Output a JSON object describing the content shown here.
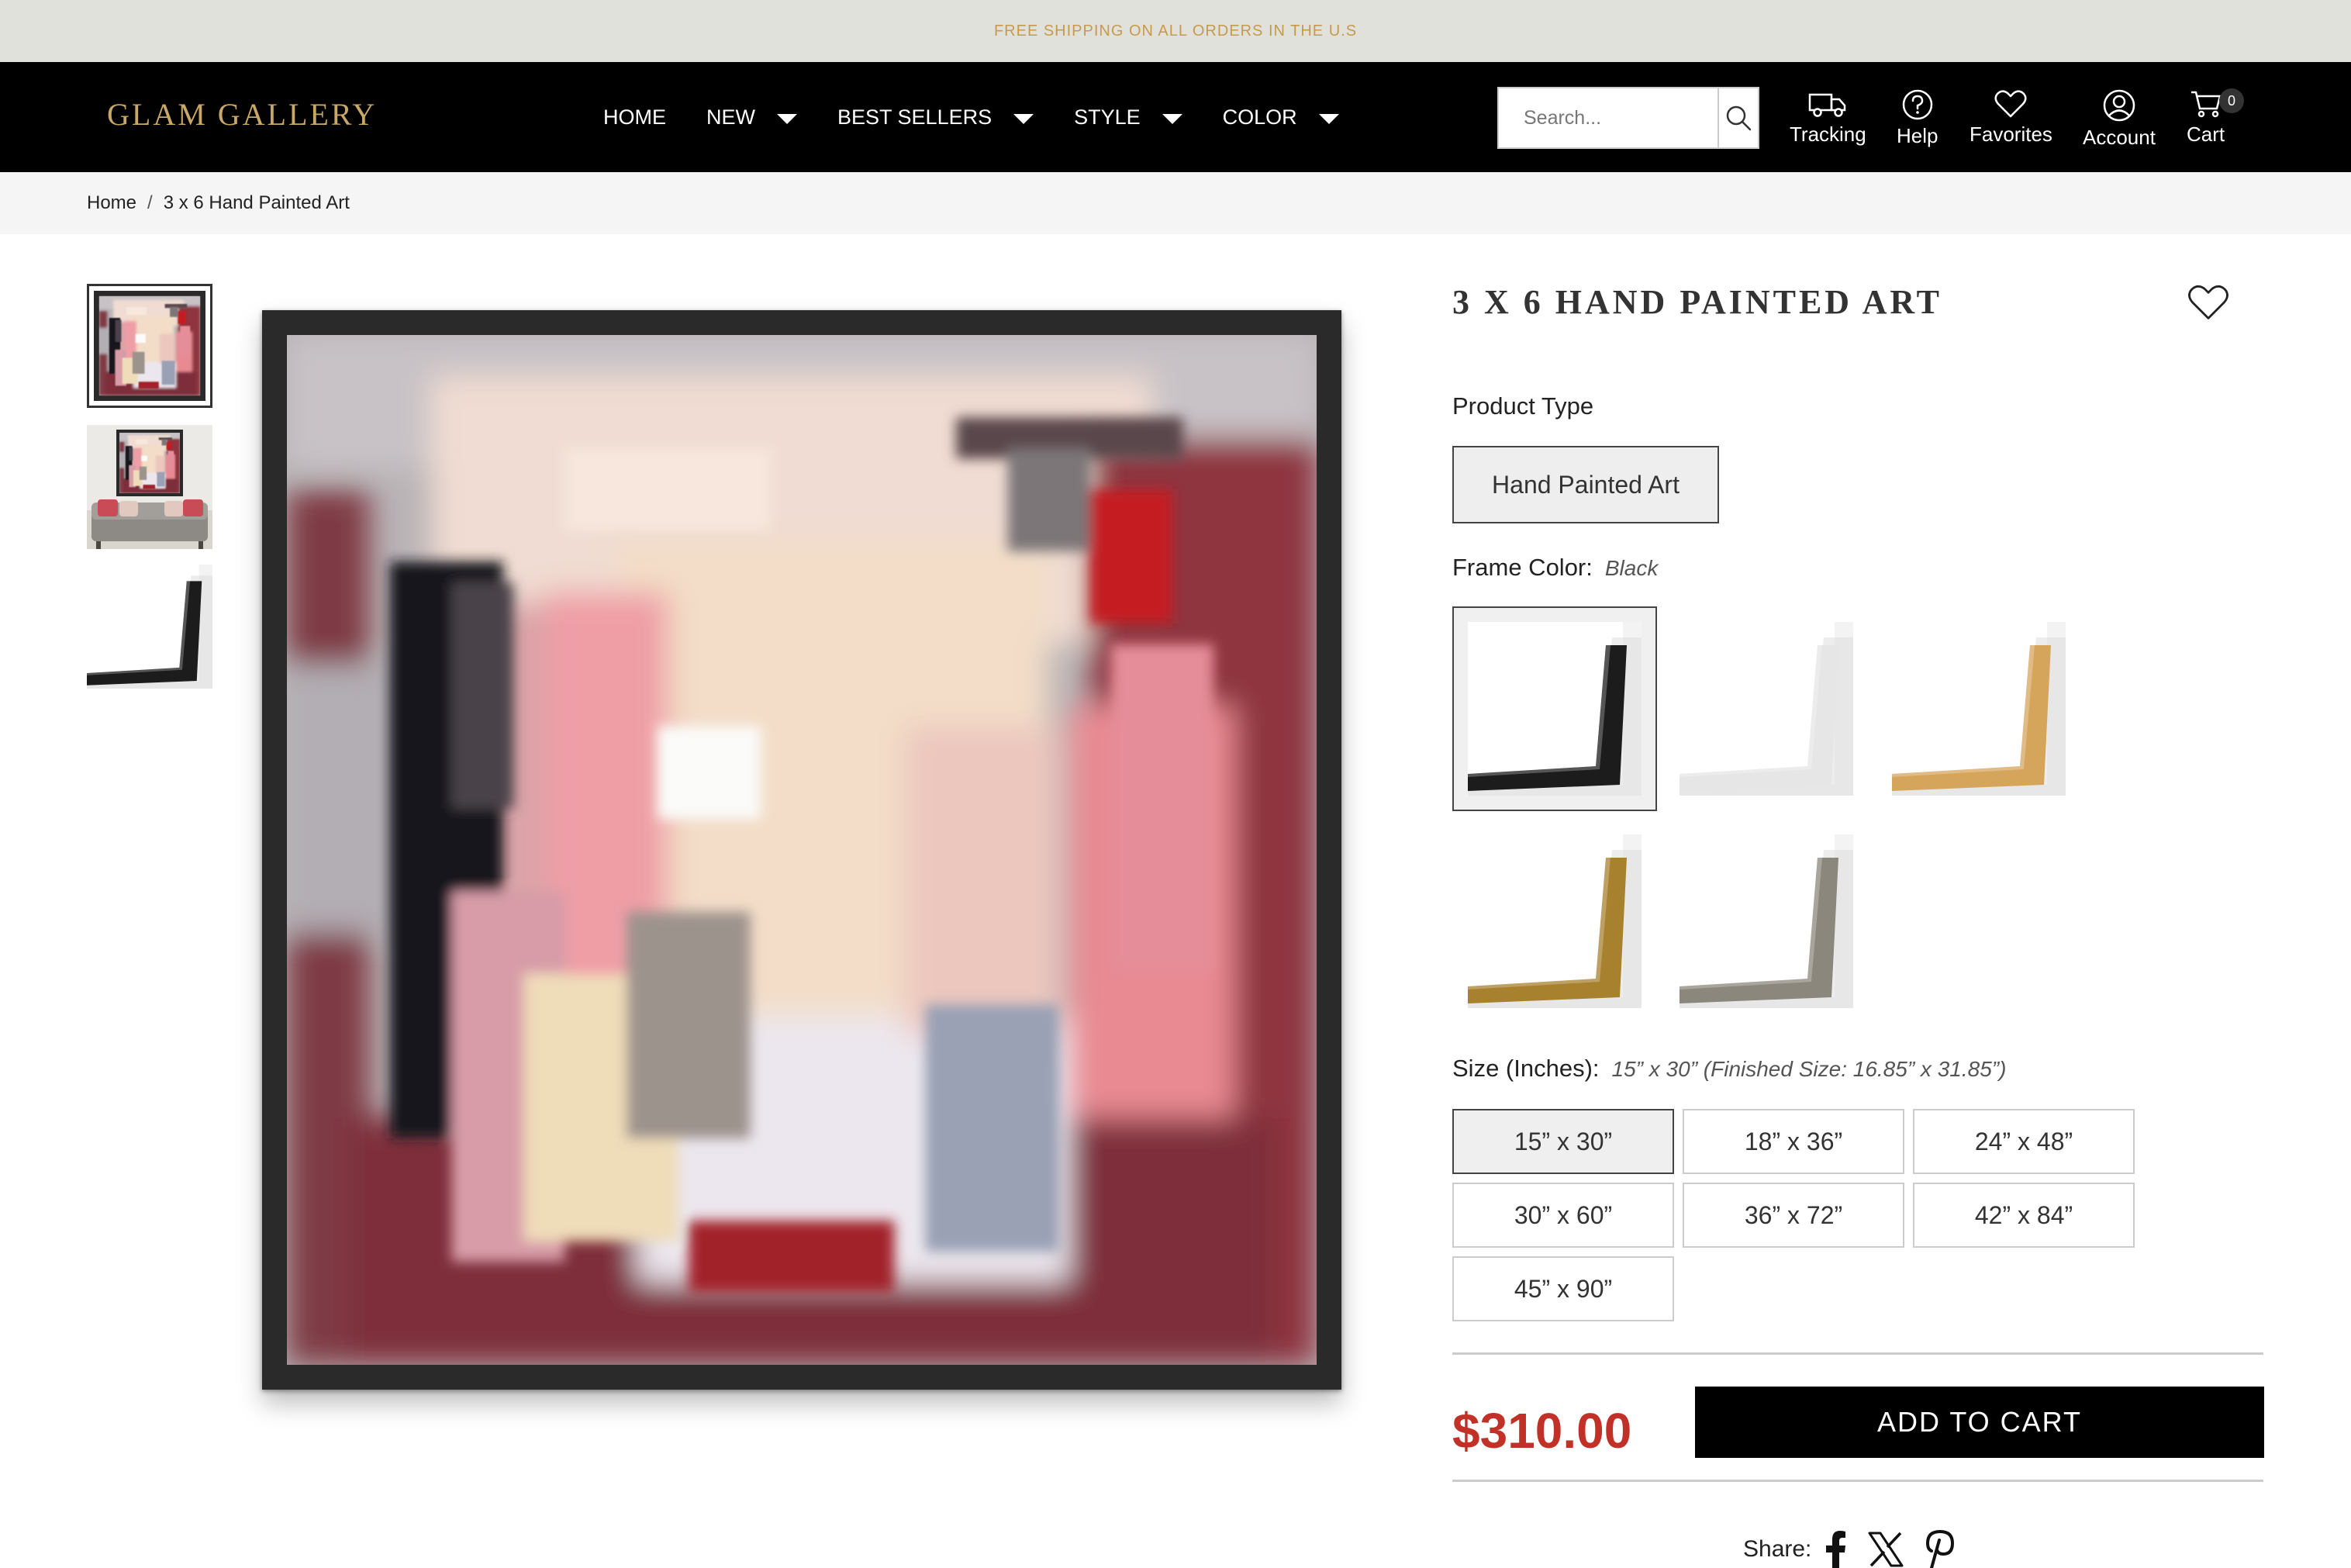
{
  "announcement": "FREE SHIPPING ON ALL ORDERS IN THE U.S",
  "brand": "GLAM GALLERY",
  "nav": {
    "items": [
      {
        "label": "HOME"
      },
      {
        "label": "NEW"
      },
      {
        "label": "BEST SELLERS"
      },
      {
        "label": "STYLE"
      },
      {
        "label": "COLOR"
      }
    ]
  },
  "search": {
    "placeholder": "Search..."
  },
  "utility": {
    "tracking": "Tracking",
    "help": "Help",
    "favorites": "Favorites",
    "account": "Account",
    "cart": "Cart",
    "cart_count": "0"
  },
  "breadcrumb": {
    "home": "Home",
    "separator": "/",
    "current": "3 x 6 Hand Painted Art"
  },
  "product": {
    "title": "3 X 6 HAND PAINTED ART",
    "type_label": "Product Type",
    "type_value": "Hand Painted Art",
    "frame_label": "Frame Color:",
    "frame_selected": "Black",
    "frame_options": [
      "Black",
      "White",
      "Oak",
      "Gold",
      "Silver"
    ],
    "size_label": "Size (Inches):",
    "size_selected": "15” x 30” (Finished Size: 16.85” x 31.85”)",
    "sizes": [
      "15” x 30”",
      "18” x 36”",
      "24” x 48”",
      "30” x 60”",
      "36” x 72”",
      "42” x 84”",
      "45” x 90”"
    ],
    "price": "$310.00",
    "add_to_cart": "ADD TO CART",
    "share_label": "Share:"
  },
  "colors": {
    "announce_bg": "#e1e1dc",
    "announce_text": "#c79a4b",
    "header_bg": "#000000",
    "logo_gold": "#c9a766",
    "price_red": "#c23127"
  },
  "icons": [
    "search-icon",
    "truck-icon",
    "help-icon",
    "heart-icon",
    "account-icon",
    "cart-icon",
    "facebook-icon",
    "x-icon",
    "pinterest-icon",
    "chevron-down-icon"
  ]
}
